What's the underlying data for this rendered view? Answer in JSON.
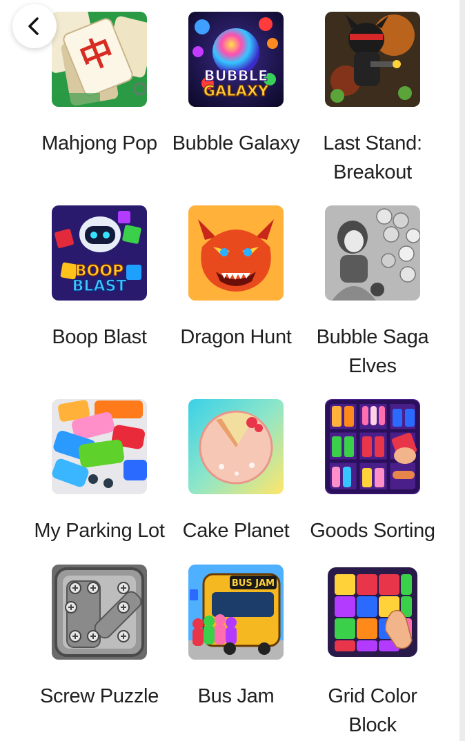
{
  "nav": {
    "back_icon": "chevron-left-icon"
  },
  "games": [
    {
      "title": "Mahjong Pop",
      "icon": "mahjong-tile-icon"
    },
    {
      "title": "Bubble Galaxy",
      "icon": "bubble-galaxy-icon",
      "logo_text_1": "BUBBLE",
      "logo_text_2": "GALAXY"
    },
    {
      "title": "Last Stand: Breakout",
      "icon": "last-stand-icon"
    },
    {
      "title": "Boop Blast",
      "icon": "boop-blast-icon",
      "logo_text_1": "BOOP",
      "logo_text_2": "BLAST"
    },
    {
      "title": "Dragon Hunt",
      "icon": "dragon-icon"
    },
    {
      "title": "Bubble Saga Elves",
      "icon": "bubble-saga-icon"
    },
    {
      "title": "My Parking Lot",
      "icon": "parking-cars-icon"
    },
    {
      "title": "Cake Planet",
      "icon": "cake-planet-icon"
    },
    {
      "title": "Goods Sorting",
      "icon": "goods-shelf-icon"
    },
    {
      "title": "Screw Puzzle",
      "icon": "screw-puzzle-icon"
    },
    {
      "title": "Bus Jam",
      "icon": "bus-jam-icon",
      "logo_text": "BUS JAM"
    },
    {
      "title": "Grid Color Block",
      "icon": "color-block-icon"
    }
  ],
  "colors": {
    "background": "#ffffff",
    "text": "#1f1f1f",
    "mahjong_green": "#1f8a3a",
    "bubble_galaxy_bg": "#1a1240",
    "dragon_orange": "#e8491d",
    "bus_yellow": "#f5b820"
  }
}
